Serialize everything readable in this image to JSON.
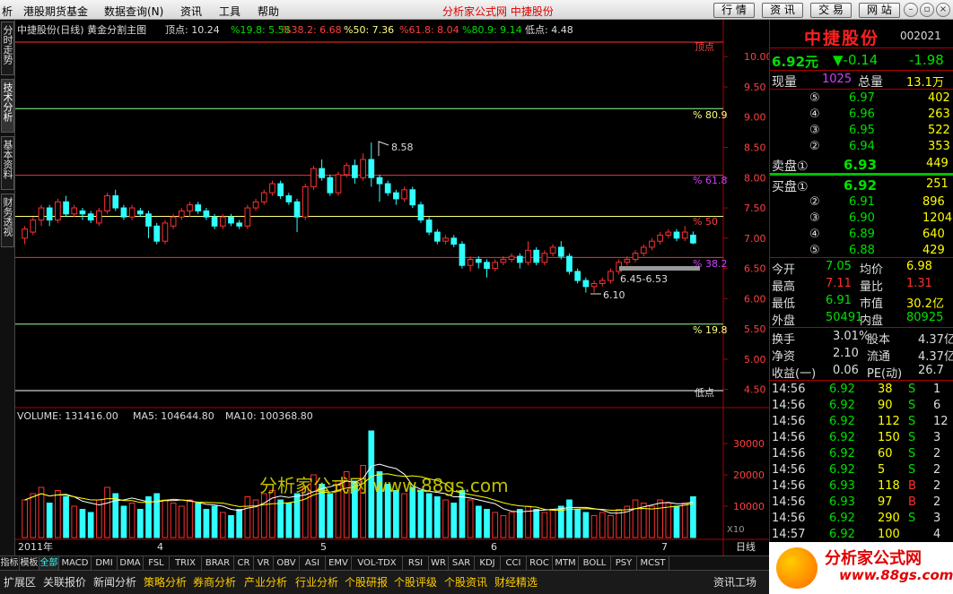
{
  "menubar": {
    "items": [
      "析",
      "港股期货基金",
      "数据查询(N)",
      "资讯",
      "工具",
      "帮助"
    ],
    "center_title": "分析家公式网  中捷股份",
    "buttons": [
      "行 情",
      "资 讯",
      "交 易",
      "网 站"
    ]
  },
  "left_tabs": [
    "分时走势",
    "技术分析",
    "基本资料",
    "财务透视"
  ],
  "main_chart": {
    "header": {
      "name": "中捷股份(日线) 黄金分割主图",
      "top_label": "顶点: 10.24",
      "p19": "%19.8: 5.58",
      "p38": "%38.2: 6.68",
      "p50": "%50: 7.36",
      "p61": "%61.8: 8.04",
      "p80": "%80.9: 9.14",
      "low_label": "低点: 4.48"
    },
    "right_labels": {
      "top": "顶点",
      "p80": "% 80.9",
      "p61": "% 61.8",
      "p50": "% 50",
      "p38": "% 38.2",
      "p19": "% 19.8",
      "bottom": "低点"
    },
    "annotations": {
      "high": "8.58",
      "low": "6.10",
      "range": "6.45-6.53"
    },
    "price_ticks": [
      "10.00",
      "9.50",
      "9.00",
      "8.50",
      "8.00",
      "7.50",
      "7.00",
      "6.50",
      "6.00",
      "5.50",
      "5.00",
      "4.50"
    ],
    "volume": {
      "label": "VOLUME: 131416.00",
      "ma5": "MA5: 104644.80",
      "ma10": "MA10: 100368.80",
      "ticks": [
        "30000",
        "20000",
        "10000"
      ],
      "unit": "X10"
    },
    "date_axis": [
      "2011年",
      "4",
      "5",
      "6",
      "7"
    ],
    "period": "日线",
    "watermark": "分析家公式网 www.88gs.com"
  },
  "chart_data": {
    "type": "candlestick",
    "y_range": [
      4.4,
      10.3
    ],
    "golden_levels": [
      10.24,
      9.14,
      8.04,
      7.36,
      6.68,
      5.58,
      4.48
    ],
    "candles": [
      [
        7.0,
        7.15,
        6.9,
        7.2
      ],
      [
        7.1,
        7.3,
        7.05,
        7.35
      ],
      [
        7.3,
        7.5,
        7.2,
        7.55
      ],
      [
        7.5,
        7.3,
        7.2,
        7.55
      ],
      [
        7.3,
        7.6,
        7.25,
        7.65
      ],
      [
        7.6,
        7.4,
        7.35,
        7.7
      ],
      [
        7.4,
        7.5,
        7.35,
        7.55
      ],
      [
        7.45,
        7.4,
        7.3,
        7.5
      ],
      [
        7.4,
        7.3,
        7.25,
        7.45
      ],
      [
        7.25,
        7.45,
        7.2,
        7.5
      ],
      [
        7.45,
        7.7,
        7.4,
        7.75
      ],
      [
        7.7,
        7.5,
        7.45,
        7.8
      ],
      [
        7.5,
        7.35,
        7.3,
        7.55
      ],
      [
        7.35,
        7.5,
        7.3,
        7.55
      ],
      [
        7.45,
        7.4,
        7.35,
        7.5
      ],
      [
        7.4,
        7.2,
        7.0,
        7.45
      ],
      [
        7.2,
        6.95,
        6.9,
        7.25
      ],
      [
        6.95,
        7.25,
        6.9,
        7.3
      ],
      [
        7.2,
        7.35,
        7.15,
        7.4
      ],
      [
        7.35,
        7.45,
        7.3,
        7.5
      ],
      [
        7.45,
        7.55,
        7.35,
        7.6
      ],
      [
        7.55,
        7.45,
        7.4,
        7.6
      ],
      [
        7.45,
        7.35,
        7.3,
        7.5
      ],
      [
        7.35,
        7.2,
        7.15,
        7.4
      ],
      [
        7.2,
        7.35,
        7.15,
        7.4
      ],
      [
        7.35,
        7.25,
        7.2,
        7.4
      ],
      [
        7.25,
        7.2,
        7.15,
        7.3
      ],
      [
        7.2,
        7.5,
        7.15,
        7.55
      ],
      [
        7.5,
        7.6,
        7.45,
        7.65
      ],
      [
        7.6,
        7.75,
        7.55,
        7.8
      ],
      [
        7.75,
        7.9,
        7.7,
        7.95
      ],
      [
        7.9,
        7.7,
        7.65,
        7.95
      ],
      [
        7.7,
        7.6,
        7.55,
        7.75
      ],
      [
        7.6,
        7.35,
        7.1,
        7.65
      ],
      [
        7.35,
        7.85,
        7.3,
        7.9
      ],
      [
        7.85,
        8.15,
        7.8,
        8.2
      ],
      [
        8.15,
        8.0,
        7.95,
        8.3
      ],
      [
        8.0,
        7.75,
        7.7,
        8.05
      ],
      [
        7.75,
        8.05,
        7.7,
        8.1
      ],
      [
        8.05,
        8.2,
        8.0,
        8.25
      ],
      [
        8.2,
        8.0,
        7.9,
        8.3
      ],
      [
        8.0,
        8.3,
        7.95,
        8.4
      ],
      [
        8.3,
        8.0,
        7.85,
        8.58
      ],
      [
        8.0,
        7.9,
        7.6,
        8.05
      ],
      [
        7.9,
        7.75,
        7.7,
        7.95
      ],
      [
        7.75,
        7.65,
        7.55,
        7.8
      ],
      [
        7.65,
        7.8,
        7.6,
        7.85
      ],
      [
        7.8,
        7.55,
        7.5,
        7.85
      ],
      [
        7.55,
        7.3,
        7.25,
        7.6
      ],
      [
        7.3,
        7.1,
        7.05,
        7.35
      ],
      [
        7.1,
        6.95,
        6.9,
        7.15
      ],
      [
        6.95,
        7.0,
        6.9,
        7.05
      ],
      [
        7.0,
        6.9,
        6.85,
        7.05
      ],
      [
        6.9,
        6.55,
        6.5,
        6.95
      ],
      [
        6.55,
        6.65,
        6.45,
        6.7
      ],
      [
        6.65,
        6.6,
        6.5,
        6.7
      ],
      [
        6.6,
        6.5,
        6.35,
        6.65
      ],
      [
        6.5,
        6.6,
        6.45,
        6.65
      ],
      [
        6.6,
        6.65,
        6.55,
        6.7
      ],
      [
        6.65,
        6.7,
        6.6,
        6.75
      ],
      [
        6.7,
        6.6,
        6.5,
        6.75
      ],
      [
        6.6,
        6.8,
        6.55,
        6.95
      ],
      [
        6.8,
        6.6,
        6.55,
        6.85
      ],
      [
        6.6,
        6.75,
        6.55,
        6.8
      ],
      [
        6.75,
        6.85,
        6.7,
        6.9
      ],
      [
        6.85,
        6.7,
        6.65,
        6.95
      ],
      [
        6.7,
        6.45,
        6.4,
        6.75
      ],
      [
        6.45,
        6.3,
        6.25,
        6.5
      ],
      [
        6.3,
        6.2,
        6.1,
        6.35
      ],
      [
        6.2,
        6.25,
        6.1,
        6.3
      ],
      [
        6.25,
        6.3,
        6.2,
        6.35
      ],
      [
        6.3,
        6.45,
        6.25,
        6.5
      ],
      [
        6.45,
        6.6,
        6.4,
        6.65
      ],
      [
        6.6,
        6.65,
        6.55,
        6.7
      ],
      [
        6.65,
        6.75,
        6.6,
        6.8
      ],
      [
        6.75,
        6.85,
        6.7,
        6.9
      ],
      [
        6.85,
        6.95,
        6.8,
        7.0
      ],
      [
        6.95,
        7.05,
        6.9,
        7.1
      ],
      [
        7.05,
        7.1,
        7.0,
        7.15
      ],
      [
        7.1,
        7.0,
        6.95,
        7.15
      ],
      [
        7.0,
        7.1,
        6.95,
        7.2
      ],
      [
        7.05,
        6.92,
        6.9,
        7.11
      ]
    ],
    "volumes": [
      12000,
      14000,
      16000,
      11000,
      15000,
      13000,
      10000,
      9000,
      8000,
      12000,
      16000,
      14000,
      10000,
      11000,
      9000,
      13000,
      14000,
      12000,
      11000,
      10000,
      12000,
      11000,
      9000,
      10000,
      8000,
      7000,
      9000,
      13000,
      12000,
      14000,
      15000,
      12000,
      11000,
      14000,
      16000,
      20000,
      17000,
      14000,
      18000,
      21000,
      18000,
      23000,
      34000,
      21000,
      17000,
      15000,
      14000,
      16000,
      15000,
      14000,
      13000,
      12000,
      11000,
      15000,
      12000,
      10000,
      9000,
      8000,
      7000,
      8000,
      9000,
      10000,
      9000,
      8000,
      9000,
      10000,
      12000,
      9000,
      8000,
      7000,
      8000,
      7000,
      9000,
      10000,
      12000,
      11000,
      10000,
      12000,
      11000,
      10000,
      11000,
      13000
    ]
  },
  "right_panel": {
    "name": "中捷股份",
    "code": "002021",
    "price": "6.92元",
    "change": "▼-0.14",
    "pct": "-1.98",
    "cur_vol_label": "现量",
    "cur_vol": "1025",
    "total_vol_label": "总量",
    "total_vol": "13.1万",
    "sells": [
      {
        "lv": "⑤",
        "p": "6.97",
        "v": "402"
      },
      {
        "lv": "④",
        "p": "6.96",
        "v": "263"
      },
      {
        "lv": "③",
        "p": "6.95",
        "v": "522"
      },
      {
        "lv": "②",
        "p": "6.94",
        "v": "353"
      }
    ],
    "sell1_label": "卖盘①",
    "sell1_p": "6.93",
    "sell1_v": "449",
    "buy1_label": "买盘①",
    "buy1_p": "6.92",
    "buy1_v": "251",
    "buys": [
      {
        "lv": "②",
        "p": "6.91",
        "v": "896"
      },
      {
        "lv": "③",
        "p": "6.90",
        "v": "1204"
      },
      {
        "lv": "④",
        "p": "6.89",
        "v": "640"
      },
      {
        "lv": "⑤",
        "p": "6.88",
        "v": "429"
      }
    ],
    "stats": [
      [
        "今开",
        "7.05",
        "均价",
        "6.98"
      ],
      [
        "最高",
        "7.11",
        "量比",
        "1.31"
      ],
      [
        "最低",
        "6.91",
        "市值",
        "30.2亿"
      ],
      [
        "外盘",
        "50491",
        "内盘",
        "80925"
      ]
    ],
    "stats2": [
      [
        "换手",
        "3.01%",
        "股本",
        "4.37亿"
      ],
      [
        "净资",
        "2.10",
        "流通",
        "4.37亿"
      ],
      [
        "收益(一)",
        "0.06",
        "PE(动)",
        "26.7"
      ]
    ],
    "ticks": [
      [
        "14:56",
        "6.92",
        "38",
        "S",
        "1"
      ],
      [
        "14:56",
        "6.92",
        "90",
        "S",
        "6"
      ],
      [
        "14:56",
        "6.92",
        "112",
        "S",
        "12"
      ],
      [
        "14:56",
        "6.92",
        "150",
        "S",
        "3"
      ],
      [
        "14:56",
        "6.92",
        "60",
        "S",
        "2"
      ],
      [
        "14:56",
        "6.92",
        "5",
        "S",
        "2"
      ],
      [
        "14:56",
        "6.93",
        "118",
        "B",
        "2"
      ],
      [
        "14:56",
        "6.93",
        "97",
        "B",
        "2"
      ],
      [
        "14:56",
        "6.92",
        "290",
        "S",
        "3"
      ],
      [
        "14:57",
        "6.92",
        "100",
        "",
        "4"
      ]
    ]
  },
  "indicator_tabs": [
    "指标",
    "模板",
    "全部",
    "MACD",
    "DMI",
    "DMA",
    "FSL",
    "TRIX",
    "BRAR",
    "CR",
    "VR",
    "OBV",
    "ASI",
    "EMV",
    "VOL-TDX",
    "RSI",
    "WR",
    "SAR",
    "KDJ",
    "CCI",
    "ROC",
    "MTM",
    "BOLL",
    "PSY",
    "MCST"
  ],
  "bottom_tabs": [
    "扩展区",
    "关联报价",
    "新闻分析",
    "策略分析",
    "券商分析",
    "产业分析",
    "行业分析",
    "个股研报",
    "个股评级",
    "个股资讯",
    "财经精选"
  ],
  "bottom_right": "资讯工场",
  "logo": {
    "t1": "分析家公式网",
    "t2": "www.88gs.com"
  }
}
